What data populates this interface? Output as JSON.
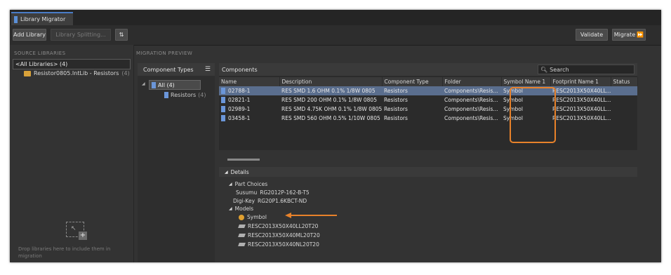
{
  "window": {
    "tab_title": "Library Migrator"
  },
  "toolbar": {
    "add_library": "Add Library",
    "library_splitting": "Library Splitting...",
    "validate": "Validate",
    "migrate": "Migrate"
  },
  "source": {
    "header": "SOURCE LIBRARIES",
    "all_item": "<All Libraries> (4)",
    "lib_name": "Resistor0805.IntLib - Resistors",
    "lib_count": "(4)",
    "drop_text": "Drop libraries here to include them in migration"
  },
  "preview": {
    "header": "MIGRATION PREVIEW"
  },
  "component_types": {
    "header": "Component Types",
    "all_label": "All (4)",
    "resistors_label": "Resistors",
    "resistors_count": "(4)"
  },
  "components": {
    "header": "Components",
    "search_placeholder": "Search",
    "columns": [
      "Name",
      "Description",
      "Component Type",
      "Folder",
      "Symbol Name 1",
      "Footprint Name 1",
      "Status"
    ],
    "rows": [
      [
        "02788-1",
        "RES SMD 1.6 OHM 0.1% 1/8W 0805",
        "Resistors",
        "Components\\Resis...",
        "Symbol",
        "RESC2013X50X40LL...",
        ""
      ],
      [
        "02821-1",
        "RES SMD 200 OHM 0.1% 1/8W 0805",
        "Resistors",
        "Components\\Resis...",
        "Symbol",
        "RESC2013X50X40LL...",
        ""
      ],
      [
        "02989-1",
        "RES SMD 4.75K OHM 0.1% 1/8W 0805",
        "Resistors",
        "Components\\Resis...",
        "Symbol",
        "RESC2013X50X40LL...",
        ""
      ],
      [
        "03458-1",
        "RES SMD 560 OHM 0.5% 1/10W 0805",
        "Resistors",
        "Components\\Resis...",
        "Symbol",
        "RESC2013X50X40LL...",
        ""
      ]
    ]
  },
  "details": {
    "header": "Details",
    "part_choices": "Part Choices",
    "supplier1_name": "Susumu",
    "supplier1_part": "RG2012P-162-B-T5",
    "supplier2_name": "Digi-Key",
    "supplier2_part": "RG20P1.6KBCT-ND",
    "models": "Models",
    "model_items": [
      "Symbol",
      "RESC2013X50X40LL20T20",
      "RESC2013X50X40ML20T20",
      "RESC2013X50X40NL20T20"
    ]
  },
  "colors": {
    "highlight": "#e8822a",
    "selection": "#5a6e8e",
    "accent": "#4a7cc7"
  }
}
